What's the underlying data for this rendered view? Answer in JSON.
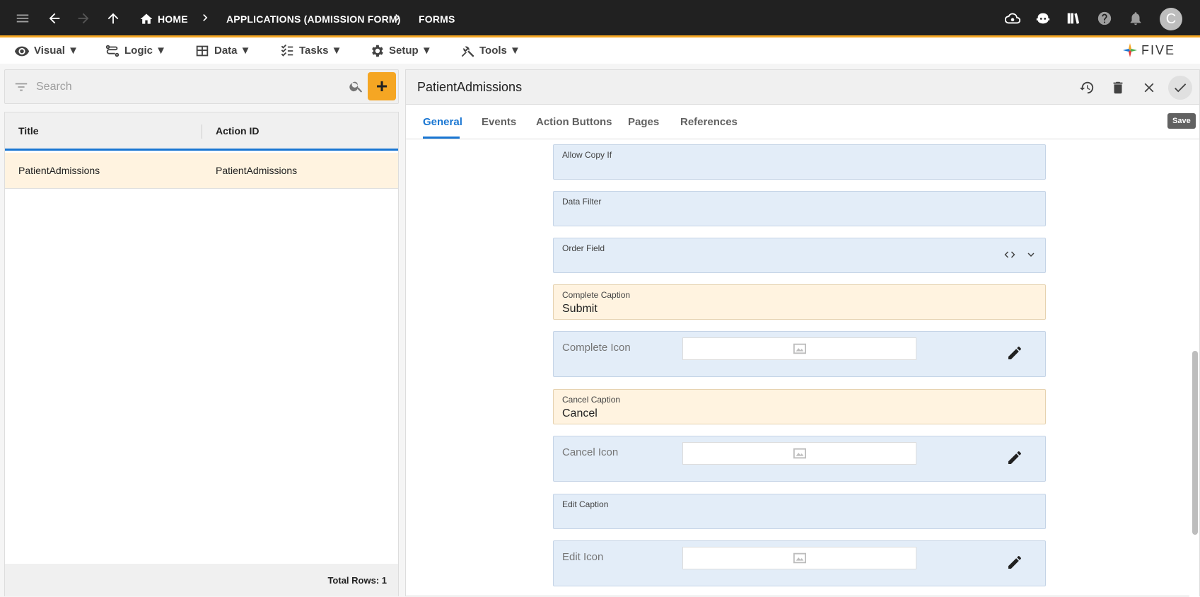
{
  "topbar": {
    "breadcrumbs": [
      "HOME",
      "APPLICATIONS (ADMISSION FORM)",
      "FORMS"
    ],
    "avatar_initial": "C"
  },
  "menubar": {
    "items": [
      "Visual ▼",
      "Logic ▼",
      "Data ▼",
      "Tasks ▼",
      "Setup ▼",
      "Tools ▼"
    ],
    "logo_text": "FIVE"
  },
  "search": {
    "placeholder": "Search",
    "add_label": "+"
  },
  "list": {
    "columns": [
      "Title",
      "Action ID"
    ],
    "rows": [
      {
        "title": "PatientAdmissions",
        "action_id": "PatientAdmissions"
      }
    ],
    "total_rows": "Total Rows: 1"
  },
  "detail": {
    "title": "PatientAdmissions",
    "save_tooltip": "Save",
    "tabs": [
      "General",
      "Events",
      "Action Buttons",
      "Pages",
      "References"
    ],
    "fields": {
      "allow_copy_if": {
        "label": "Allow Copy If",
        "value": ""
      },
      "data_filter": {
        "label": "Data Filter",
        "value": ""
      },
      "order_field": {
        "label": "Order Field",
        "value": ""
      },
      "complete_caption": {
        "label": "Complete Caption",
        "value": "Submit"
      },
      "complete_icon": {
        "label": "Complete Icon"
      },
      "cancel_caption": {
        "label": "Cancel Caption",
        "value": "Cancel"
      },
      "cancel_icon": {
        "label": "Cancel Icon"
      },
      "edit_caption": {
        "label": "Edit Caption",
        "value": ""
      },
      "edit_icon": {
        "label": "Edit Icon"
      }
    }
  }
}
